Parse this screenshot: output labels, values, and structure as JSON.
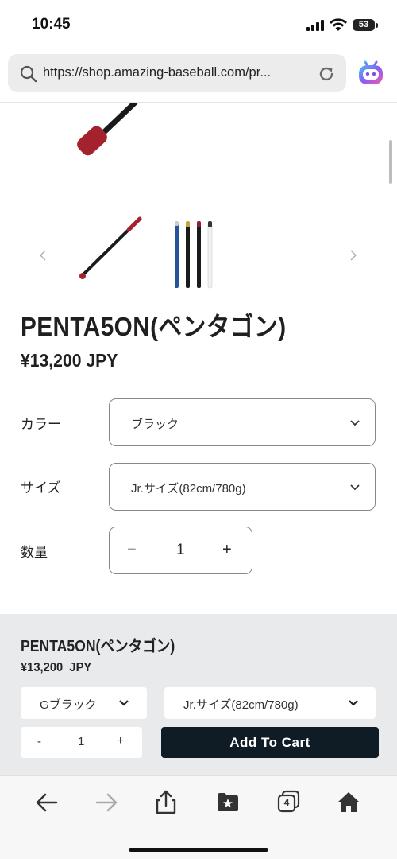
{
  "status_bar": {
    "time": "10:45",
    "battery": "53"
  },
  "browser": {
    "url": "https://shop.amazing-baseball.com/pr..."
  },
  "product": {
    "title": "PENTA5ON(ペンタゴン)",
    "price": "¥13,200 JPY",
    "options": {
      "color_label": "カラー",
      "color_value": "ブラック",
      "size_label": "サイズ",
      "size_value": "Jr.サイズ(82cm/780g)",
      "quantity_label": "数量",
      "quantity_value": "1",
      "minus": "−",
      "plus": "+"
    }
  },
  "sticky_bar": {
    "title": "PENTA5ON(ペンタゴン)",
    "price": "¥13,200  JPY",
    "color_value": "Gブラック",
    "size_value": "Jr.サイズ(82cm/780g)",
    "quantity_value": "1",
    "minus": "-",
    "plus": "+",
    "add_to_cart": "Add To Cart"
  },
  "toolbar": {
    "tabs_count": "4"
  },
  "colors": {
    "cart_button": "#0f1c26",
    "sticky_bg": "#e9eaec",
    "bat_red": "#a4222e"
  }
}
